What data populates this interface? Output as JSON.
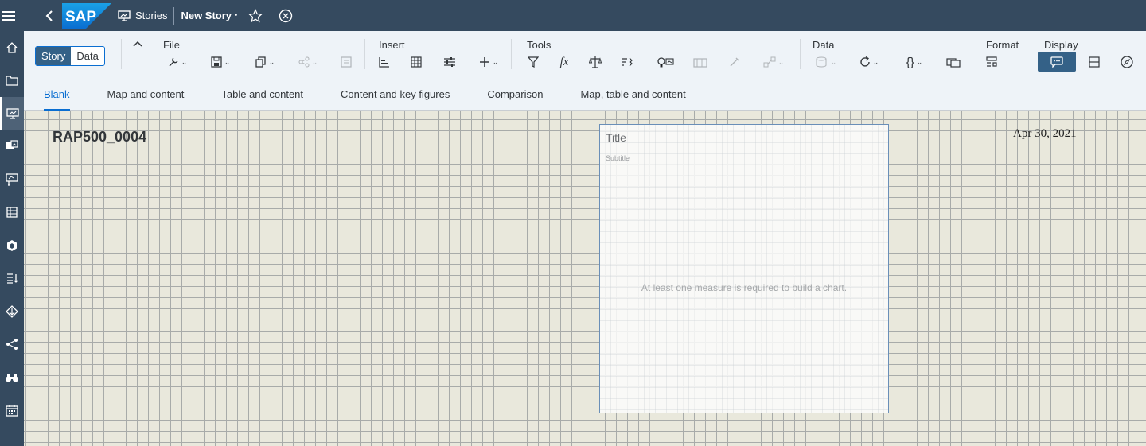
{
  "shell": {
    "stories_label": "Stories",
    "story_title": "New Story",
    "unsaved_marker": "•",
    "logo_text": "SAP"
  },
  "toolbar": {
    "segments": {
      "story": "Story",
      "data": "Data"
    },
    "groups": {
      "file": "File",
      "insert": "Insert",
      "tools": "Tools",
      "data": "Data",
      "format": "Format",
      "display": "Display"
    }
  },
  "tabs": [
    {
      "label": "Blank",
      "selected": true
    },
    {
      "label": "Map and content",
      "selected": false
    },
    {
      "label": "Table and content",
      "selected": false
    },
    {
      "label": "Content and key figures",
      "selected": false
    },
    {
      "label": "Comparison",
      "selected": false
    },
    {
      "label": "Map, table and content",
      "selected": false
    }
  ],
  "canvas": {
    "page_name": "RAP500_0004",
    "date": "Apr 30, 2021",
    "chart": {
      "title": "Title",
      "subtitle": "Subtitle",
      "message": "At least one measure is required to build a chart."
    }
  },
  "colors": {
    "shell": "#354a5f",
    "accent": "#0a6ed1",
    "selected_button": "#346187",
    "canvas_bg": "#e9e8dc"
  }
}
